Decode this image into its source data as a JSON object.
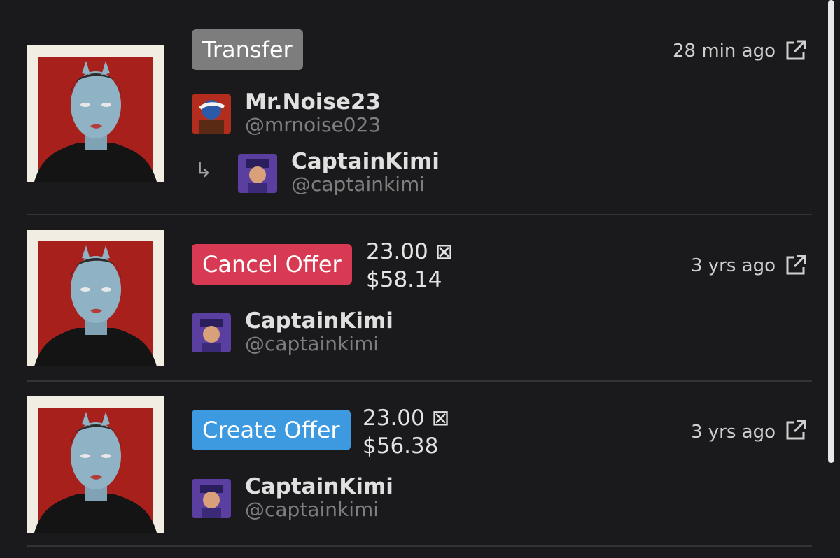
{
  "activity": [
    {
      "event": "Transfer",
      "event_color": "#7d7d7d",
      "time": "28 min ago",
      "from": {
        "name": "Mr.Noise23",
        "handle": "@mrnoise023"
      },
      "arrow": "↳",
      "to": {
        "name": "CaptainKimi",
        "handle": "@captainkimi"
      }
    },
    {
      "event": "Cancel Offer",
      "event_color": "#d93a53",
      "price": "23.00 ⊠",
      "usd": "$58.14",
      "time": "3 yrs ago",
      "user": {
        "name": "CaptainKimi",
        "handle": "@captainkimi"
      }
    },
    {
      "event": "Create Offer",
      "event_color": "#3d9ae0",
      "price": "23.00 ⊠",
      "usd": "$56.38",
      "time": "3 yrs ago",
      "user": {
        "name": "CaptainKimi",
        "handle": "@captainkimi"
      }
    }
  ],
  "icons": {
    "external_link": "external-link-icon",
    "transfer_arrow": "arrow-turn-right-icon"
  }
}
